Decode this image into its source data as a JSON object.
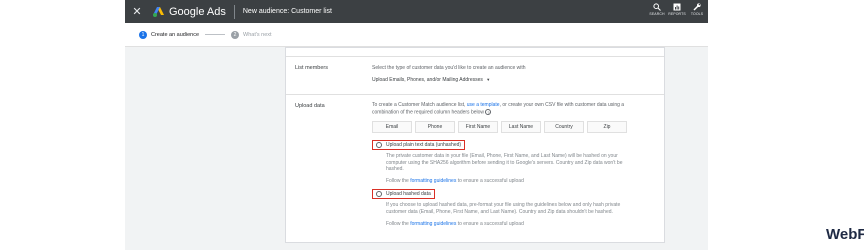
{
  "header": {
    "brand": "Google Ads",
    "title": "New audience: Customer list",
    "tools": [
      {
        "icon": "search-icon",
        "label": "SEARCH"
      },
      {
        "icon": "reports-icon",
        "label": "REPORTS"
      },
      {
        "icon": "tools-icon",
        "label": "TOOLS"
      }
    ]
  },
  "steps": [
    {
      "num": "1",
      "label": "Create an audience"
    },
    {
      "num": "2",
      "label": "What's next"
    }
  ],
  "list_members": {
    "label": "List members",
    "description": "Select the type of customer data you'd like to create an audience with",
    "dropdown": "Upload Emails, Phones, and/or Mailing Addresses"
  },
  "upload_data": {
    "label": "Upload data",
    "intro_pre": "To create a Customer Match audience list, ",
    "intro_link": "use a template",
    "intro_post": ", or create your own CSV file with customer data using a",
    "intro_line2": "combination of the required column headers below",
    "column_headers": [
      "Email",
      "Phone",
      "First Name",
      "Last Name",
      "Country",
      "Zip"
    ],
    "option_plain": {
      "label": "Upload plain text data (unhashed)",
      "desc_line1": "The private customer data in your file (Email, Phone, First Name, and Last Name) will be hashed on your",
      "desc_line2": "computer using the SHA256 algorithm before sending it to Google's servers. Country and Zip data won't be",
      "desc_line3": "hashed.",
      "follow_pre": "Follow the ",
      "follow_link": "formatting guidelines",
      "follow_post": " to ensure a successful upload"
    },
    "option_hashed": {
      "label": "Upload hashed data",
      "desc_line1": "If you choose to upload hashed data, pre-format your file using the guidelines below and only hash private",
      "desc_line2": "customer data (Email, Phone, First Name, and Last Name). Country and Zip data shouldn't be hashed.",
      "follow_pre": "Follow the ",
      "follow_link": "formatting guidelines",
      "follow_post": " to ensure a successful upload"
    }
  },
  "watermark": "WebFX",
  "colors": {
    "topbar": "#3c4043",
    "step_active": "#1a73e8",
    "step_inactive": "#9aa0a6",
    "link": "#1a73e8",
    "highlight": "#d93025"
  }
}
